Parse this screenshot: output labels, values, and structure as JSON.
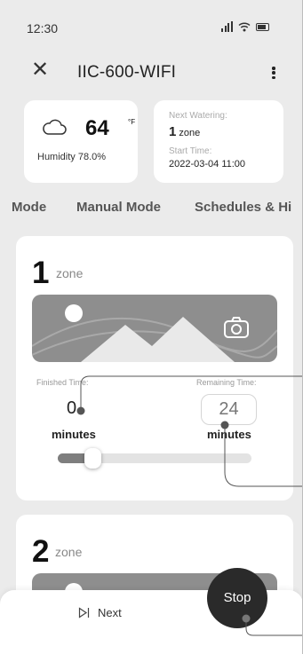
{
  "status_bar": {
    "time": "12:30"
  },
  "header": {
    "title": "IIC-600-WIFI"
  },
  "weather": {
    "temperature": "64",
    "unit": "°F",
    "humidity": "Humidity 78.0%"
  },
  "next_watering": {
    "label": "Next Watering:",
    "zone_number": "1",
    "zone_word": "zone",
    "start_label": "Start Time:",
    "start_time": "2022-03-04 11:00"
  },
  "tabs": [
    {
      "label": "Mode"
    },
    {
      "label": "Manual Mode"
    },
    {
      "label": "Schedules & Hi"
    }
  ],
  "zones": [
    {
      "number": "1",
      "label": "zone",
      "finished_label": "Finished Time:",
      "finished_value": "0",
      "finished_unit": "minutes",
      "remaining_label": "Remaining Time:",
      "remaining_value": "24",
      "remaining_unit": "minutes",
      "progress": 0.14
    },
    {
      "number": "2",
      "label": "zone"
    }
  ],
  "bottom_bar": {
    "next_label": "Next",
    "stop_label": "Stop"
  },
  "colors": {
    "background": "#ebebeb",
    "card": "#ffffff",
    "stop_button": "#2a2a2a",
    "image_placeholder": "#8e8e8e"
  }
}
